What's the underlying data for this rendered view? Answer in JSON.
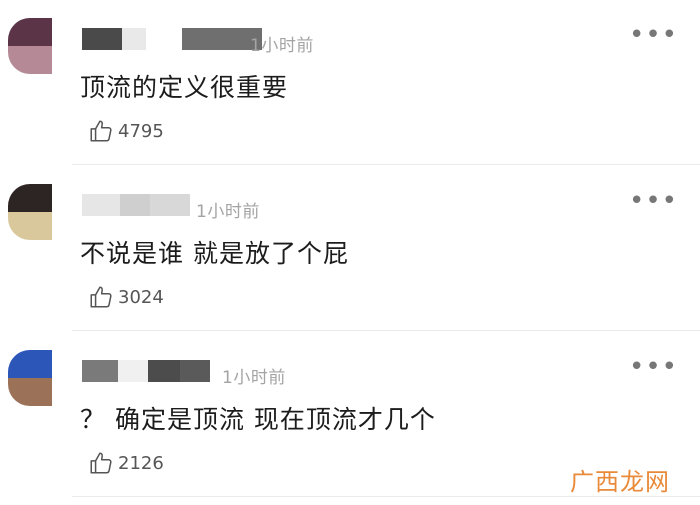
{
  "comments": [
    {
      "time": "1小时前",
      "text": "顶流的定义很重要",
      "likes": "4795",
      "more_label": "•••",
      "avatar_colors": [
        "#5b3448",
        "#b58a96"
      ]
    },
    {
      "time": "1小时前",
      "text": "不说是谁 就是放了个屁",
      "likes": "3024",
      "more_label": "•••",
      "avatar_colors": [
        "#2d2523",
        "#d9c89c"
      ]
    },
    {
      "time": "1小时前",
      "text": "？ 确定是顶流 现在顶流才几个",
      "likes": "2126",
      "more_label": "•••",
      "avatar_colors": [
        "#2c56b8",
        "#9b7158"
      ]
    }
  ],
  "watermark": "广西龙网",
  "icons": {
    "like": "thumbs-up-icon",
    "more": "more-dots-icon"
  }
}
